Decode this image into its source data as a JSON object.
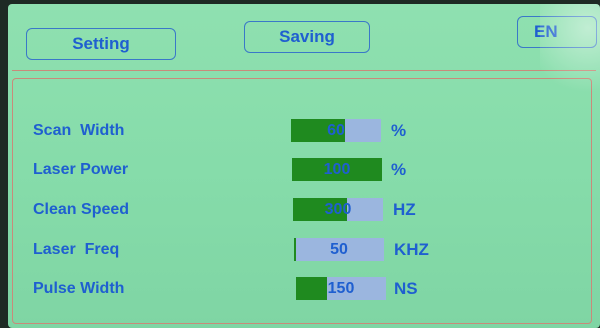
{
  "header": {
    "setting_label": "Setting",
    "saving_label": "Saving",
    "language_label": "EN"
  },
  "params": [
    {
      "label": "Scan  Width",
      "value": "60",
      "fraction": 0.6,
      "unit": "%"
    },
    {
      "label": "Laser Power",
      "value": "100",
      "fraction": 1.0,
      "unit": "%"
    },
    {
      "label": "Clean Speed",
      "value": "300",
      "fraction": 0.6,
      "unit": "HZ"
    },
    {
      "label": "Laser  Freq",
      "value": "50",
      "fraction": 0.0,
      "unit": "KHZ"
    },
    {
      "label": "Pulse Width",
      "value": "150",
      "fraction": 0.35,
      "unit": "NS"
    }
  ],
  "colors": {
    "background": "#8fe0b0",
    "text": "#1f5fd0",
    "bar_track": "#9bb6df",
    "bar_fill": "#1f8a1f"
  }
}
